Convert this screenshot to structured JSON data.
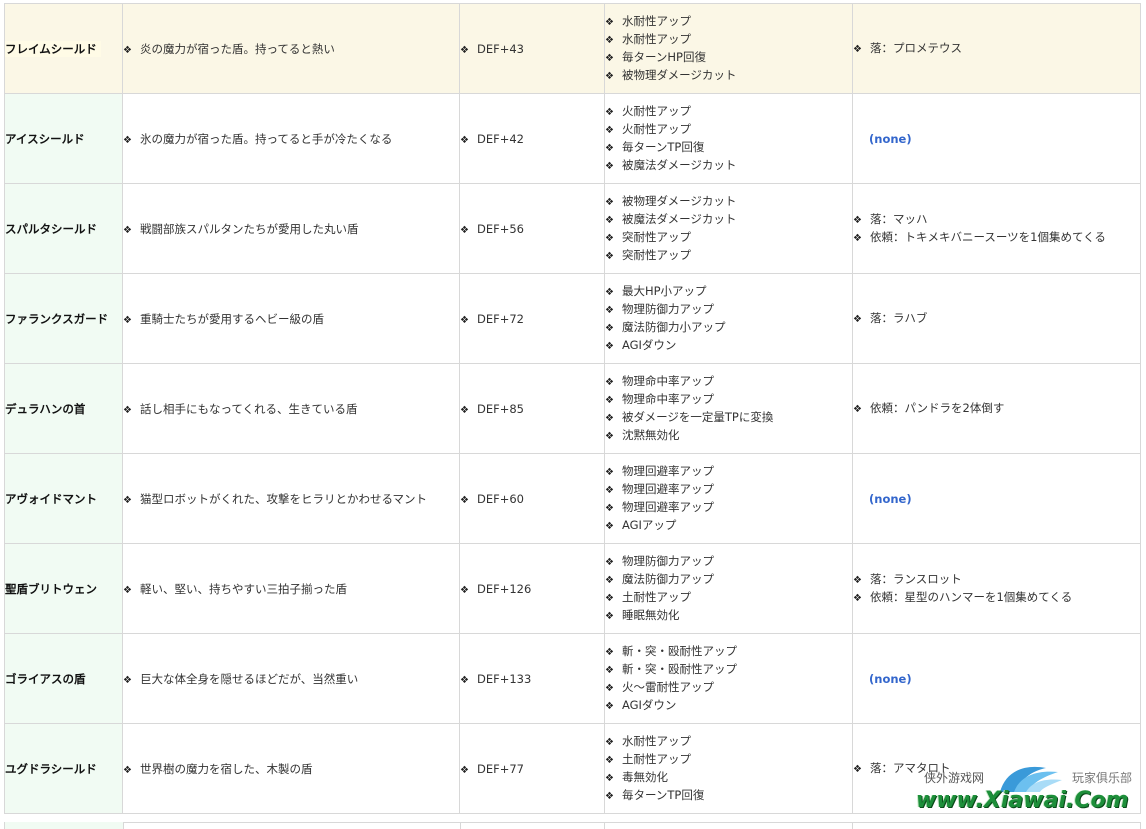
{
  "rows": [
    {
      "name": "フレイムシールド",
      "description": "炎の魔力が宿った盾。持ってると熱い",
      "def": "DEF+43",
      "effects": [
        "水耐性アップ",
        "水耐性アップ",
        "毎ターンHP回復",
        "被物理ダメージカット"
      ],
      "source": [
        "落：プロメテウス"
      ],
      "highlighted": true
    },
    {
      "name": "アイスシールド",
      "description": "氷の魔力が宿った盾。持ってると手が冷たくなる",
      "def": "DEF+42",
      "effects": [
        "火耐性アップ",
        "火耐性アップ",
        "毎ターンTP回復",
        "被魔法ダメージカット"
      ],
      "source": [],
      "source_none": "(none)"
    },
    {
      "name": "スパルタシールド",
      "description": "戦闘部族スパルタンたちが愛用した丸い盾",
      "def": "DEF+56",
      "effects": [
        "被物理ダメージカット",
        "被魔法ダメージカット",
        "突耐性アップ",
        "突耐性アップ"
      ],
      "source": [
        "落：マッハ",
        "依頼：トキメキバニースーツを1個集めてくる"
      ]
    },
    {
      "name": "ファランクスガード",
      "description": "重騎士たちが愛用するヘビー級の盾",
      "def": "DEF+72",
      "effects": [
        "最大HP小アップ",
        "物理防御力アップ",
        "魔法防御力小アップ",
        "AGIダウン"
      ],
      "source": [
        "落：ラハブ"
      ]
    },
    {
      "name": "デュラハンの首",
      "description": "話し相手にもなってくれる、生きている盾",
      "def": "DEF+85",
      "effects": [
        "物理命中率アップ",
        "物理命中率アップ",
        "被ダメージを一定量TPに変換",
        "沈黙無効化"
      ],
      "source": [
        "依頼：パンドラを2体倒す"
      ]
    },
    {
      "name": "アヴォイドマント",
      "description": "猫型ロボットがくれた、攻撃をヒラリとかわせるマント",
      "def": "DEF+60",
      "effects": [
        "物理回避率アップ",
        "物理回避率アップ",
        "物理回避率アップ",
        "AGIアップ"
      ],
      "source": [],
      "source_none": "(none)"
    },
    {
      "name": "聖盾ブリトウェン",
      "description": "軽い、堅い、持ちやすい三拍子揃った盾",
      "def": "DEF+126",
      "effects": [
        "物理防御力アップ",
        "魔法防御力アップ",
        "土耐性アップ",
        "睡眠無効化"
      ],
      "source": [
        "落：ランスロット",
        "依頼：星型のハンマーを1個集めてくる"
      ]
    },
    {
      "name": "ゴライアスの盾",
      "description": "巨大な体全身を隠せるほどだが、当然重い",
      "def": "DEF+133",
      "effects": [
        "斬・突・殴耐性アップ",
        "斬・突・殴耐性アップ",
        "火～雷耐性アップ",
        "AGIダウン"
      ],
      "source": [],
      "source_none": "(none)"
    },
    {
      "name": "ユグドラシールド",
      "description": "世界樹の魔力を宿した、木製の盾",
      "def": "DEF+77",
      "effects": [
        "水耐性アップ",
        "土耐性アップ",
        "毒無効化",
        "毎ターンTP回復"
      ],
      "source": [
        "落：アマタロト"
      ]
    }
  ],
  "bullet": "❖",
  "watermark": {
    "cn_left": "侠外游戏网",
    "cn_right": "玩家俱乐部",
    "url": "www.Xiawai.Com"
  }
}
